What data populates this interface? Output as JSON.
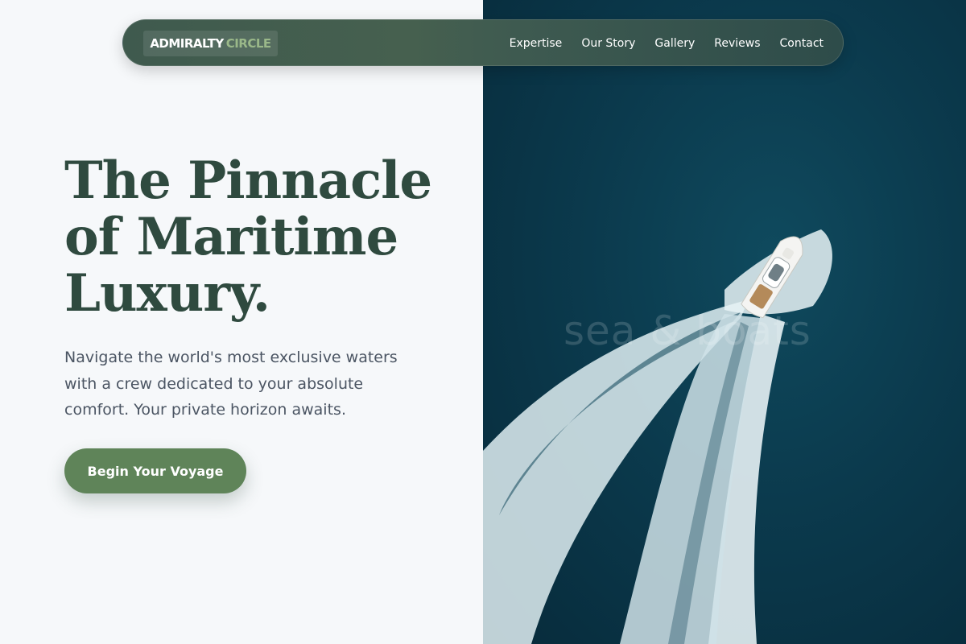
{
  "brand": {
    "name_primary": "ADMIRALTY",
    "name_secondary": "CIRCLE"
  },
  "nav": {
    "links": [
      "Expertise",
      "Our Story",
      "Gallery",
      "Reviews",
      "Contact"
    ]
  },
  "hero": {
    "title_lines": [
      "The Pinnacle",
      "of Maritime",
      "Luxury."
    ],
    "subtitle": "Navigate the world's most exclusive waters with a crew dedicated to your absolute comfort. Your private horizon awaits.",
    "cta_label": "Begin Your Voyage"
  },
  "image": {
    "overlay_text": "sea & boats"
  },
  "colors": {
    "heading": "#2f4a3f",
    "accent": "#5f8459",
    "logo_secondary": "#9ab889",
    "ocean": "#0b3a4d"
  }
}
